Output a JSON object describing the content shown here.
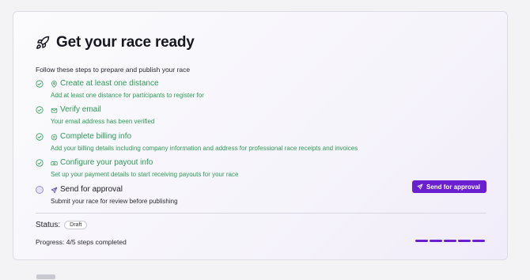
{
  "card": {
    "title": "Get your race ready",
    "intro": "Follow these steps to prepare and publish your race"
  },
  "steps": [
    {
      "label": "Create at least one distance",
      "desc": "Add at least one distance for participants to register for",
      "done": true,
      "icon": "map-pin-icon"
    },
    {
      "label": "Verify email",
      "desc": "Your email address has been verified",
      "done": true,
      "icon": "mail-icon"
    },
    {
      "label": "Complete billing info",
      "desc": "Add your billing details including company information and address for professional race receipts and invoices",
      "done": true,
      "icon": "receipt-icon"
    },
    {
      "label": "Configure your payout info",
      "desc": "Set up your payment details to start receiving payouts for your race",
      "done": true,
      "icon": "banknote-icon"
    },
    {
      "label": "Send for approval",
      "desc": "Submit your race for review before publishing",
      "done": false,
      "icon": "send-icon"
    }
  ],
  "approval_button": {
    "label": "Send for approval"
  },
  "status": {
    "label": "Status:",
    "value": "Draft"
  },
  "progress": {
    "text": "Progress: 4/5 steps completed",
    "completed": 4,
    "total": 5
  },
  "colors": {
    "accent": "#6a1fd1",
    "success": "#2e9a57"
  }
}
